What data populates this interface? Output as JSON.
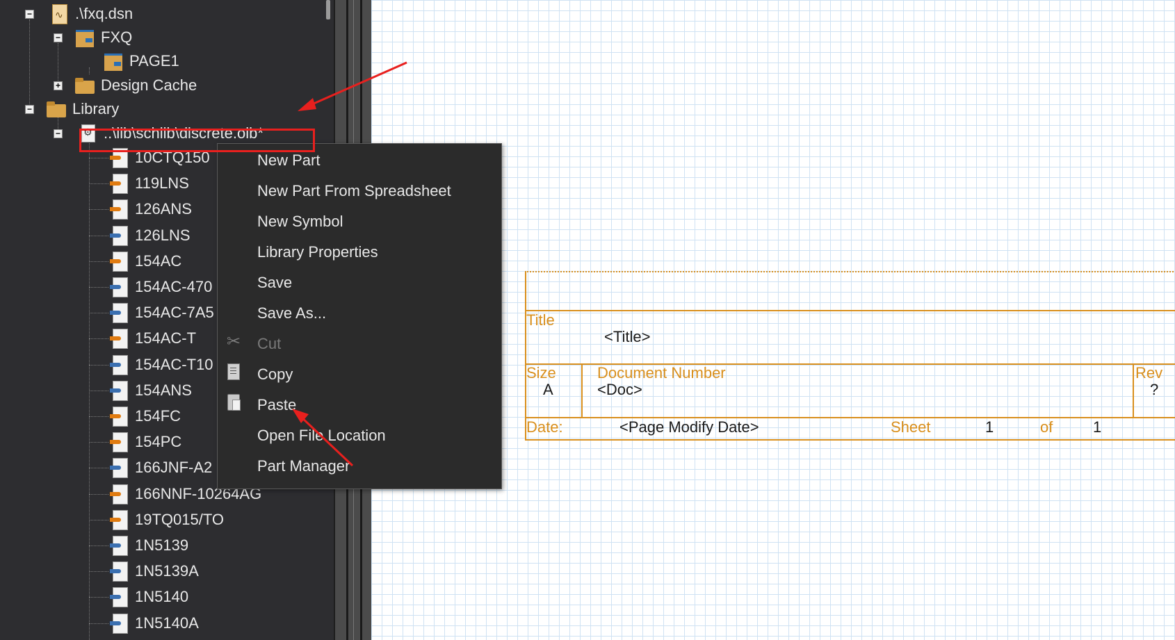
{
  "tree": {
    "items": [
      {
        "label": ".\\fxq.dsn",
        "icon": "design-file-icon",
        "expander": "−"
      },
      {
        "label": "FXQ",
        "icon": "schematic-folder-icon",
        "expander": "−"
      },
      {
        "label": "PAGE1",
        "icon": "schematic-page-icon"
      },
      {
        "label": "Design Cache",
        "icon": "folder-icon",
        "expander": "+"
      },
      {
        "label": "Library",
        "icon": "folder-icon",
        "expander": "−"
      },
      {
        "label": "..\\lib\\schlib\\discrete.olb*",
        "icon": "library-file-icon",
        "expander": "−"
      }
    ],
    "parts": [
      "10CTQ150",
      "119LNS",
      "126ANS",
      "126LNS",
      "154AC",
      "154AC-470",
      "154AC-7A5",
      "154AC-T",
      "154AC-T10",
      "154ANS",
      "154FC",
      "154PC",
      "166JNF-A2",
      "166NNF-10264AG",
      "19TQ015/TO",
      "1N5139",
      "1N5139A",
      "1N5140",
      "1N5140A"
    ]
  },
  "context_menu": {
    "items": [
      {
        "label": "New Part",
        "enabled": true,
        "icon": ""
      },
      {
        "label": "New Part From Spreadsheet",
        "enabled": true,
        "icon": ""
      },
      {
        "label": "New Symbol",
        "enabled": true,
        "icon": ""
      },
      {
        "label": "Library Properties",
        "enabled": true,
        "icon": ""
      },
      {
        "label": "Save",
        "enabled": true,
        "icon": ""
      },
      {
        "label": "Save As...",
        "enabled": true,
        "icon": ""
      },
      {
        "label": "Cut",
        "enabled": false,
        "icon": "scissors-icon"
      },
      {
        "label": "Copy",
        "enabled": true,
        "icon": "copy-icon"
      },
      {
        "label": "Paste",
        "enabled": true,
        "icon": "paste-icon"
      },
      {
        "label": "Open File Location",
        "enabled": true,
        "icon": ""
      },
      {
        "label": "Part Manager",
        "enabled": true,
        "icon": ""
      }
    ]
  },
  "title_block": {
    "title_label": "Title",
    "title_value": "<Title>",
    "size_label": "Size",
    "size_value": "A",
    "doc_label": "Document Number",
    "doc_value": "<Doc>",
    "rev_label": "Rev",
    "rev_value": "?",
    "date_label": "Date:",
    "date_value": "<Page Modify Date>",
    "sheet_label": "Sheet",
    "sheet_value": "1",
    "of_label": "of",
    "of_value": "1"
  },
  "colors": {
    "panel_bg": "#2d2d30",
    "titleblock_orange": "#d98f1c",
    "annotation_red": "#e8201e",
    "grid_blue": "#cfe2f3"
  }
}
